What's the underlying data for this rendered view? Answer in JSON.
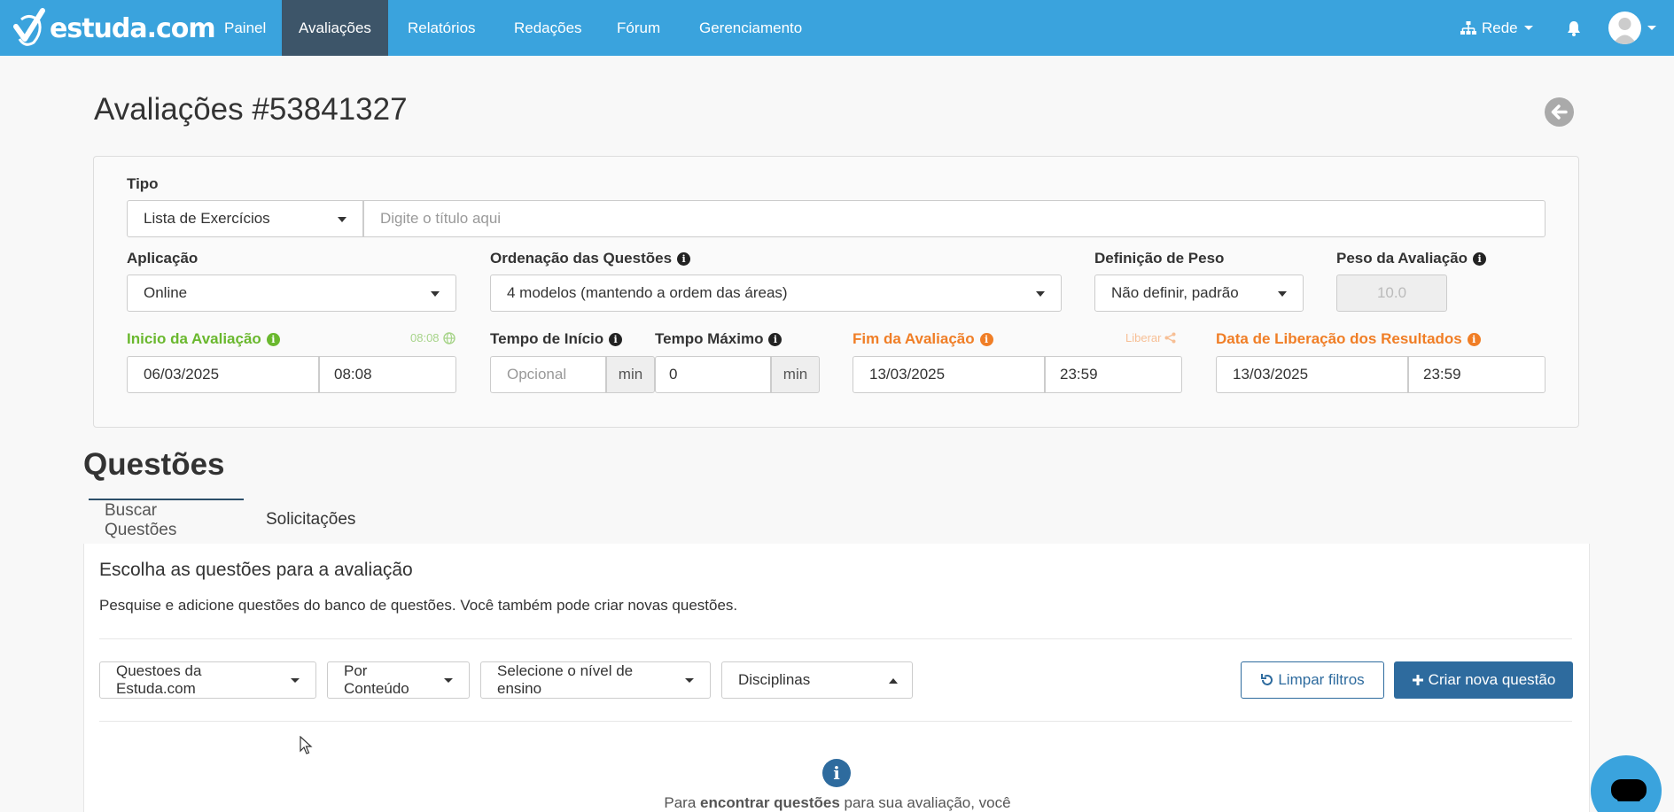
{
  "navbar": {
    "brand": "estuda.com",
    "items": [
      "Painel",
      "Avaliações",
      "Relatórios",
      "Redações",
      "Fórum",
      "Gerenciamento"
    ],
    "active_item": "Avaliações",
    "network_label": "Rede",
    "bg_color": "#3aa3dd",
    "active_color": "#3d5569"
  },
  "page": {
    "title": "Avaliações #53841327"
  },
  "form": {
    "tipo_label": "Tipo",
    "tipo_value": "Lista de Exercícios",
    "title_placeholder": "Digite o título aqui",
    "aplicacao_label": "Aplicação",
    "aplicacao_value": "Online",
    "ordenacao_label": "Ordenação das Questões",
    "ordenacao_value": "4 modelos (mantendo a ordem das áreas)",
    "peso_def_label": "Definição de Peso",
    "peso_def_value": "Não definir, padrão",
    "peso_label": "Peso da Avaliação",
    "peso_value": "10.0",
    "inicio_label": "Inicio da Avaliação",
    "inicio_time_hint": "08:08",
    "inicio_date": "06/03/2025",
    "inicio_time": "08:08",
    "tempo_inicio_label": "Tempo de Início",
    "tempo_inicio_placeholder": "Opcional",
    "tempo_inicio_unit": "min",
    "tempo_max_label": "Tempo Máximo",
    "tempo_max_value": "0",
    "tempo_max_unit": "min",
    "fim_label": "Fim da Avaliação",
    "liberar_label": "Liberar",
    "fim_date": "13/03/2025",
    "fim_time": "23:59",
    "liberacao_label": "Data de Liberação dos Resultados",
    "liberacao_date": "13/03/2025",
    "liberacao_time": "23:59",
    "green": "#6ab82e",
    "orange": "#f07e26"
  },
  "questoes": {
    "title": "Questões",
    "tabs": [
      "Buscar Questões",
      "Solicitações"
    ],
    "panel_title": "Escolha as questões para a avaliação",
    "panel_desc": "Pesquise e adicione questões do banco de questões. Você também pode criar novas questões.",
    "filters": [
      "Questoes da Estuda.com",
      "Por Conteúdo",
      "Selecione o nível de ensino",
      "Disciplinas"
    ],
    "clear_label": "Limpar filtros",
    "create_label": "Criar nova questão",
    "help_prefix": "Para ",
    "help_bold": "encontrar questões",
    "help_suffix": " para sua avaliação, você deve",
    "primary_color": "#2e6b9e"
  }
}
